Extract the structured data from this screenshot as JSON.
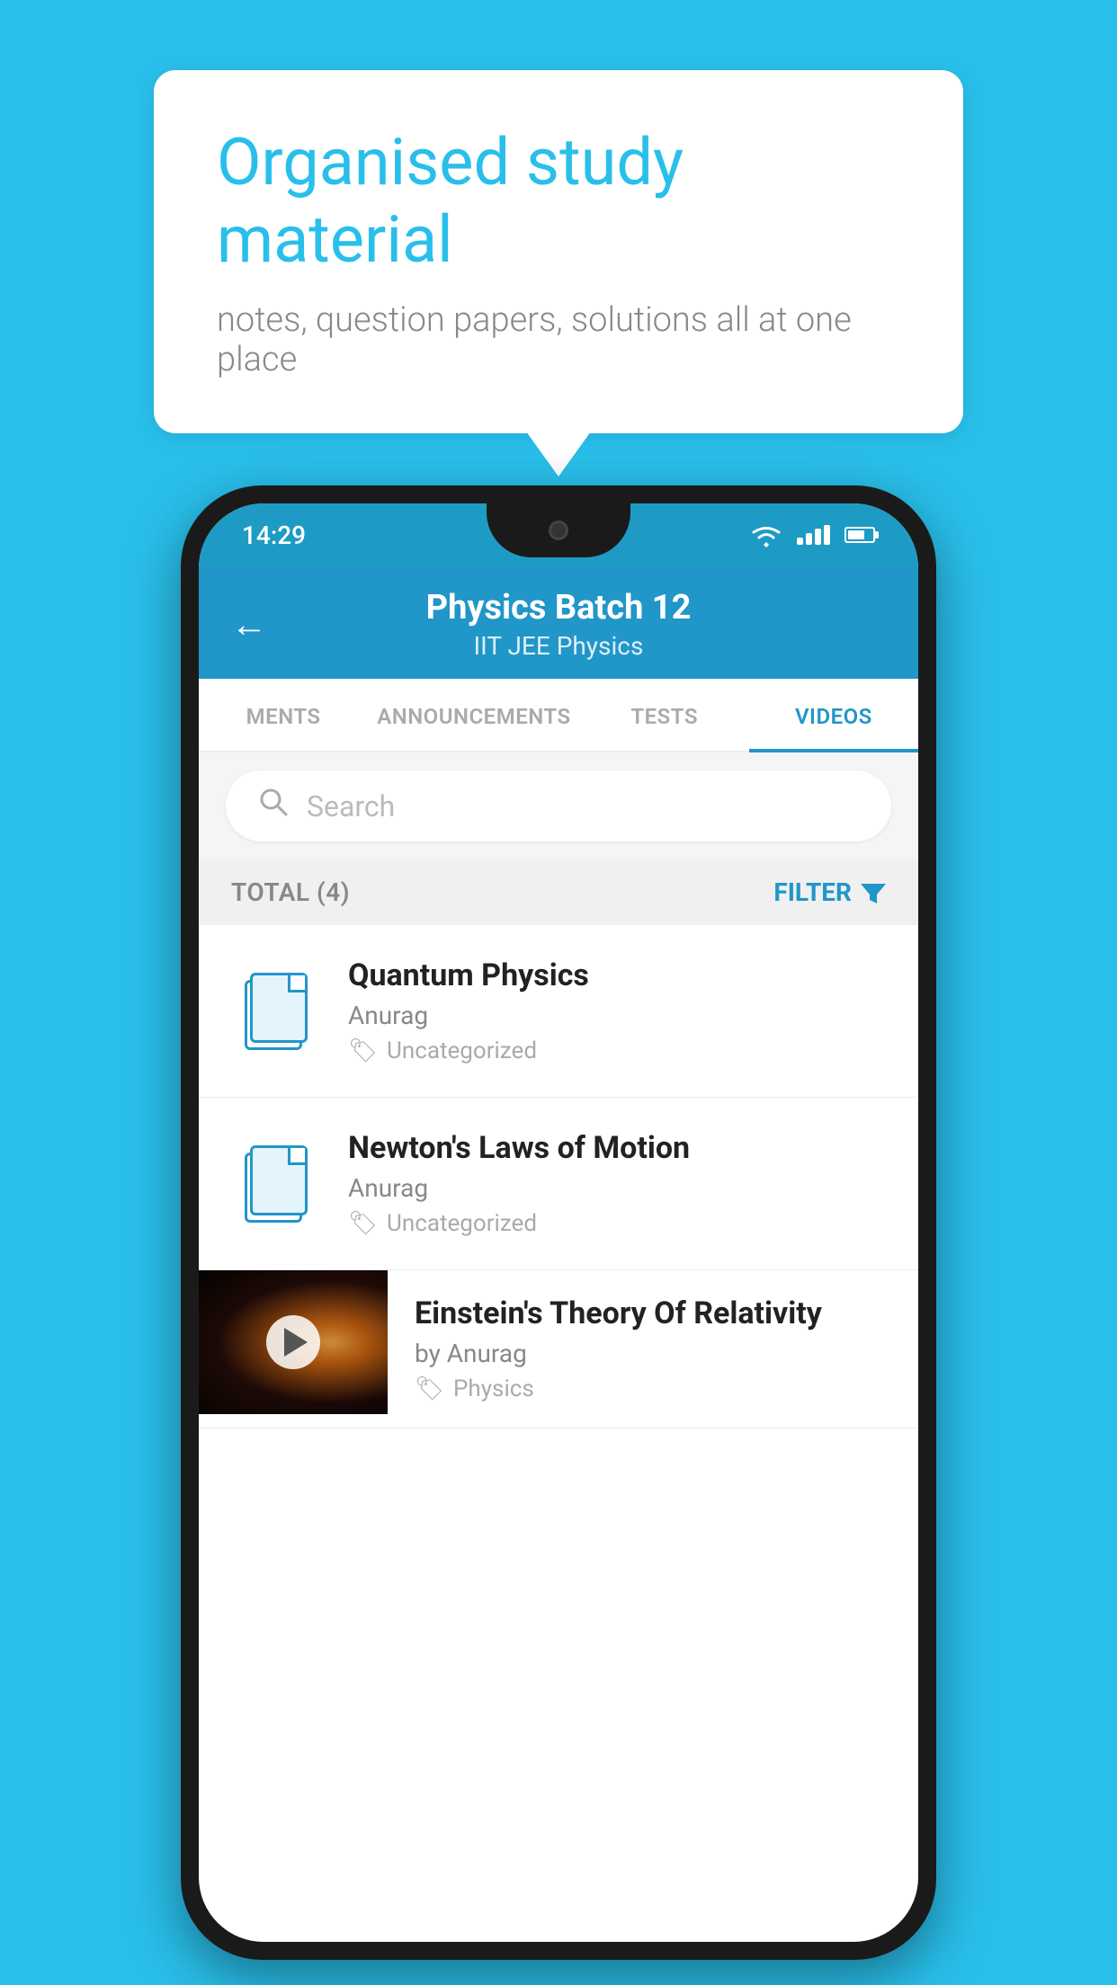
{
  "background_color": "#29BFEA",
  "bubble": {
    "title": "Organised study material",
    "subtitle": "notes, question papers, solutions all at one place"
  },
  "status_bar": {
    "time": "14:29",
    "wifi": true,
    "signal": true,
    "battery": true
  },
  "header": {
    "back_label": "←",
    "title": "Physics Batch 12",
    "subtitle_tags": "IIT JEE   Physics"
  },
  "tabs": [
    {
      "label": "MENTS",
      "active": false
    },
    {
      "label": "ANNOUNCEMENTS",
      "active": false
    },
    {
      "label": "TESTS",
      "active": false
    },
    {
      "label": "VIDEOS",
      "active": true
    }
  ],
  "search": {
    "placeholder": "Search"
  },
  "filter": {
    "total_label": "TOTAL (4)",
    "button_label": "FILTER"
  },
  "items": [
    {
      "id": 1,
      "title": "Quantum Physics",
      "author": "Anurag",
      "tag": "Uncategorized",
      "type": "doc",
      "has_thumbnail": false
    },
    {
      "id": 2,
      "title": "Newton's Laws of Motion",
      "author": "Anurag",
      "tag": "Uncategorized",
      "type": "doc",
      "has_thumbnail": false
    },
    {
      "id": 3,
      "title": "Einstein's Theory Of Relativity",
      "author": "by Anurag",
      "tag": "Physics",
      "type": "video",
      "has_thumbnail": true
    }
  ]
}
